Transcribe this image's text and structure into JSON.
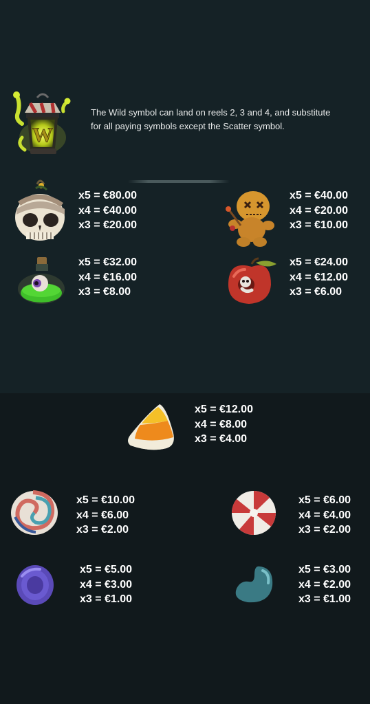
{
  "wild": {
    "icon": "wild-lantern-icon",
    "letter": "W",
    "description": "The Wild symbol can land on reels 2, 3 and 4, and substitute for all paying symbols except the Scatter symbol."
  },
  "symbols": [
    {
      "icon": "skull-icon",
      "payouts": [
        "x5 = €80.00",
        "x4 = €40.00",
        "x3 = €20.00"
      ]
    },
    {
      "icon": "voodoo-doll-icon",
      "payouts": [
        "x5 = €40.00",
        "x4 = €20.00",
        "x3 = €10.00"
      ]
    },
    {
      "icon": "eyeball-potion-icon",
      "payouts": [
        "x5 = €32.00",
        "x4 = €16.00",
        "x3 = €8.00"
      ]
    },
    {
      "icon": "worm-apple-icon",
      "payouts": [
        "x5 = €24.00",
        "x4 = €12.00",
        "x3 = €6.00"
      ]
    },
    {
      "icon": "candy-corn-icon",
      "payouts": [
        "x5 = €12.00",
        "x4 = €8.00",
        "x3 = €4.00"
      ]
    },
    {
      "icon": "swirl-lollipop-icon",
      "payouts": [
        "x5 = €10.00",
        "x4 = €6.00",
        "x3 = €2.00"
      ]
    },
    {
      "icon": "peppermint-candy-icon",
      "payouts": [
        "x5 = €6.00",
        "x4 = €4.00",
        "x3 = €2.00"
      ]
    },
    {
      "icon": "purple-candy-icon",
      "payouts": [
        "x5 = €5.00",
        "x4 = €3.00",
        "x3 = €1.00"
      ]
    },
    {
      "icon": "jelly-bean-icon",
      "payouts": [
        "x5 = €3.00",
        "x4 = €2.00",
        "x3 = €1.00"
      ]
    }
  ],
  "colors": {
    "background": "#142024",
    "text": "#ffffff",
    "wild_glow": "#d8e82a"
  }
}
